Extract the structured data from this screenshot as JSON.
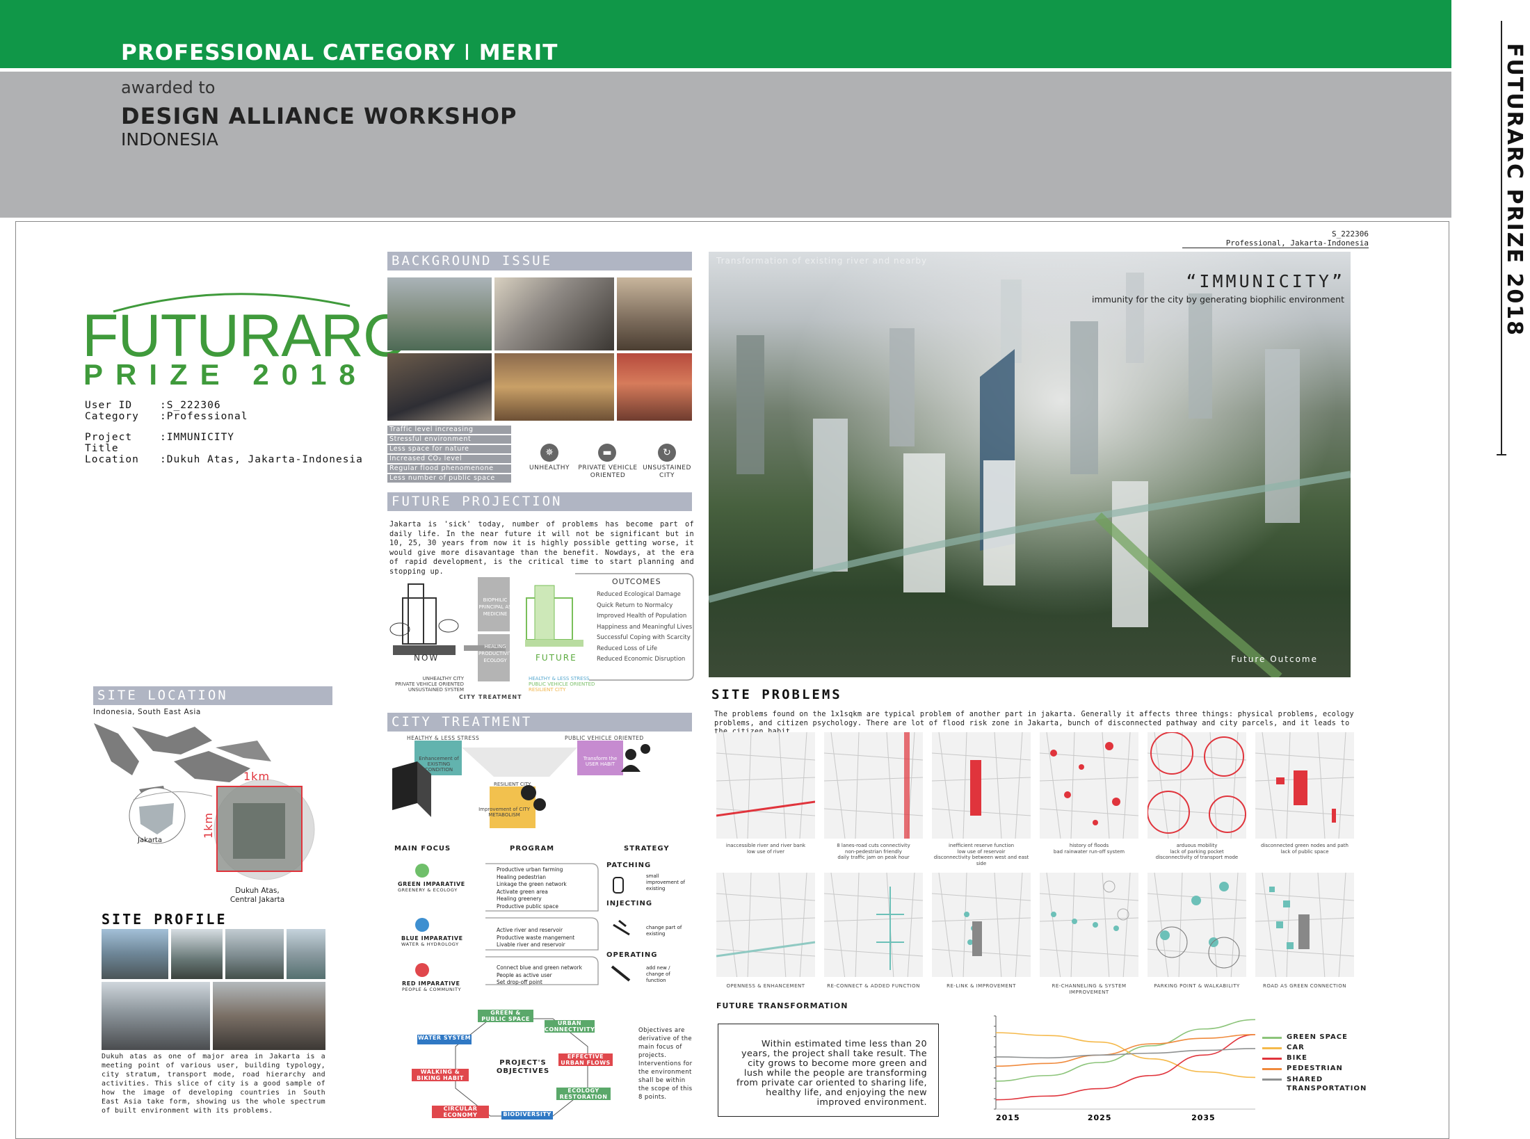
{
  "header": {
    "category": "PROFESSIONAL CATEGORY",
    "separator": "I",
    "award": "MERIT",
    "awarded_to": "awarded to",
    "winner": "DESIGN ALLIANCE WORKSHOP",
    "country": "INDONESIA",
    "side_title": "FUTURARC PRIZE 2018"
  },
  "board": {
    "ref_id": "S_222306",
    "ref_location": "Professional, Jakarta-Indonesia",
    "logo_main": "FUTURARC",
    "logo_sub": "PRIZE 2018",
    "info": [
      {
        "label": "User ID",
        "value": ":S_222306"
      },
      {
        "label": "Category",
        "value": ":Professional"
      },
      {
        "label": "Project Title",
        "value": ":IMMUNICITY"
      },
      {
        "label": "Location",
        "value": ":Dukuh Atas, Jakarta-Indonesia"
      }
    ],
    "background_issue": {
      "title": "BACKGROUND ISSUE",
      "issues": [
        "Traffic level increasing",
        "Stressful environment",
        "Less space for nature",
        "Increased CO₂ level",
        "Regular flood phenomenone",
        "Less number of public space"
      ],
      "icons": [
        {
          "icon": "virus-icon",
          "label": "UNHEALTHY"
        },
        {
          "icon": "car-icon",
          "label": "PRIVATE VEHICLE ORIENTED"
        },
        {
          "icon": "cycle-icon",
          "label": "UNSUSTAINED CITY"
        }
      ]
    },
    "future_projection": {
      "title": "FUTURE PROJECTION",
      "text": "Jakarta is 'sick' today, number of problems has become part of daily life. In the near future it will not be significant but in 10, 25, 30 years from now it is highly possible getting worse, it would give more disavantage than the benefit. Nowdays, at the era of rapid development, is the critical time to start planning and stopping up.",
      "now_label": "NOW",
      "future_label": "FUTURE",
      "medicine_label": "BIOPHILIC PRINCIPAL AS MEDICINE",
      "healing_label": "HEALING PRODUCTIVITY ECOLOGY",
      "outcomes_title": "OUTCOMES",
      "outcomes": [
        "Reduced Ecological Damage",
        "Quick Return to Normalcy",
        "Improved Health of Population",
        "Happiness and Meaningful Lives",
        "Successful Coping with Scarcity",
        "Reduced Loss of Life",
        "Reduced Economic Disruption"
      ],
      "now_list": "UNHEALTHY CITY\nPRIVATE VEHICLE ORIENTED\nUNSUSTAINED SYSTEM",
      "future_list": [
        "HEALTHY & LESS STRESS",
        "PUBLIC VEHICLE ORIENTED",
        "RESILIENT CITY"
      ],
      "city_treatment_label": "CITY TREATMENT"
    },
    "hero": {
      "overlay_text": "Transformation of existing river and nearby",
      "title": "“IMMUNICITY”",
      "subtitle": "immunity for the city by generating biophilic environment",
      "caption": "Future Outcome"
    },
    "site_location": {
      "title": "SITE LOCATION",
      "region": "Indonesia, South East Asia",
      "jakarta": "Jakarta",
      "scale_h": "1km",
      "scale_v": "1km",
      "site": "Dukuh Atas,\nCentral Jakarta"
    },
    "site_profile": {
      "title": "SITE PROFILE",
      "text": "Dukuh atas as one of major area in Jakarta is a meeting point of various user, building typology, city stratum, transport mode, road hierarchy and activities. This slice of city is a good sample of how the image of developing countries in South East Asia take form, showing us the whole spectrum of built environment with its problems."
    },
    "city_treatment": {
      "title": "CITY TREATMENT",
      "top_left": "HEALTHY & LESS STRESS",
      "top_right": "PUBLIC VEHICLE ORIENTED",
      "box_enhance": "Enhancement of EXISTING CONDITION",
      "box_transform": "Transform the USER HABIT",
      "resilient": "RESILIENT CITY",
      "box_improve": "Improvement of CITY METABOLISM",
      "col_focus": "MAIN FOCUS",
      "col_program": "PROGRAM",
      "col_strategy": "STRATEGY",
      "rows": [
        {
          "focus": "GREEN IMPARATIVE",
          "sub": "GREENERY & ECOLOGY",
          "program": "Productive urban farming\nHealing pedestrian\nLinkage the green network\nActivate green area\nHealing greenery\nProductive public space",
          "strategy": "PATCHING",
          "strategy_desc": "small improvement of existing"
        },
        {
          "focus": "BLUE IMPARATIVE",
          "sub": "WATER & HYDROLOGY",
          "program": "Active river and reservoir\nProductive waste mangement\nLivable river and reservoir",
          "strategy": "INJECTING",
          "strategy_desc": "change part of existing"
        },
        {
          "focus": "RED IMPARATIVE",
          "sub": "PEOPLE & COMMUNITY",
          "program": "Connect blue and green network\nPeople as active user\nSet drop-off point",
          "strategy": "OPERATING",
          "strategy_desc": "add new / change of function"
        }
      ],
      "objectives_center": "PROJECT'S OBJECTIVES",
      "objectives": [
        {
          "label": "GREEN & PUBLIC SPACE",
          "color": "#5aa86a"
        },
        {
          "label": "URBAN CONNECTIVITY",
          "color": "#5aa86a"
        },
        {
          "label": "EFFECTIVE URBAN FLOWS",
          "color": "#e0474c"
        },
        {
          "label": "ECOLOGY RESTORATION",
          "color": "#5aa86a"
        },
        {
          "label": "BIODIVERSITY",
          "color": "#2f78c4"
        },
        {
          "label": "CIRCULAR ECONOMY",
          "color": "#e0474c"
        },
        {
          "label": "WALKING & BIKING HABIT",
          "color": "#e0474c"
        },
        {
          "label": "WATER SYSTEM",
          "color": "#2f78c4"
        }
      ],
      "objectives_note": "Objectives are derivative of the main focus of projects. Interventions for the environment shall be within the scope of this 8 points."
    },
    "site_problems": {
      "title": "SITE PROBLEMS",
      "intro": "The problems found on the 1x1sqkm are typical problem of another part in jakarta. Generally it affects three things: physical problems, ecology problems, and citizen psychology. There are lot of flood risk zone in Jakarta, bunch of disconnected pathway and city parcels, and it leads to the citizen habit.",
      "problems": [
        "inaccessible river and river bank\nlow use of river",
        "8 lanes-road cuts connectivity\nnon-pedestrian friendly\ndaily traffic jam on peak hour",
        "inefficient reserve function\nlow use of reservoir\ndisconnectivity between west and east side",
        "history of floods\nbad rainwater run-off system",
        "arduous mobility\nlack of parking pocket\ndisconnectivity of transport mode",
        "disconnected green nodes and path\nlack of public space"
      ],
      "solutions": [
        "OPENNESS & ENHANCEMENT",
        "RE-CONNECT & ADDED FUNCTION",
        "RE-LINK & IMPROVEMENT",
        "RE-CHANNELING & SYSTEM IMPROVEMENT",
        "PARKING POINT & WALKABILITY",
        "ROAD AS GREEN CONNECTION"
      ]
    },
    "future_transformation": {
      "title": "FUTURE TRANSFORMATION",
      "text": "Within estimated time less than 20 years, the project shall take result. The city grows to become more green and lush while the people are transforming from private car oriented to sharing life, healthy life, and enjoying the new improved environment."
    }
  },
  "chart_data": {
    "type": "line",
    "x": [
      2015,
      2020,
      2025,
      2030,
      2035,
      2040
    ],
    "xticks": [
      "2015",
      "2025",
      "2035"
    ],
    "series": [
      {
        "name": "GREEN SPACE",
        "color": "#8cc47a",
        "values": [
          3.0,
          3.6,
          5.0,
          6.8,
          8.6,
          9.6
        ]
      },
      {
        "name": "CAR",
        "color": "#f5b94a",
        "values": [
          8.2,
          7.9,
          7.2,
          5.4,
          4.0,
          3.4
        ]
      },
      {
        "name": "BIKE",
        "color": "#e0343c",
        "values": [
          1.0,
          1.4,
          2.2,
          3.6,
          5.8,
          8.0
        ]
      },
      {
        "name": "PEDESTRIAN",
        "color": "#f08a3c",
        "values": [
          4.6,
          4.9,
          5.8,
          7.0,
          7.6,
          8.0
        ]
      },
      {
        "name": "SHARED TRANSPORTATION",
        "color": "#8f9191",
        "values": [
          5.6,
          5.5,
          5.8,
          6.0,
          6.3,
          6.5
        ]
      }
    ],
    "ylim": [
      0,
      10
    ]
  }
}
